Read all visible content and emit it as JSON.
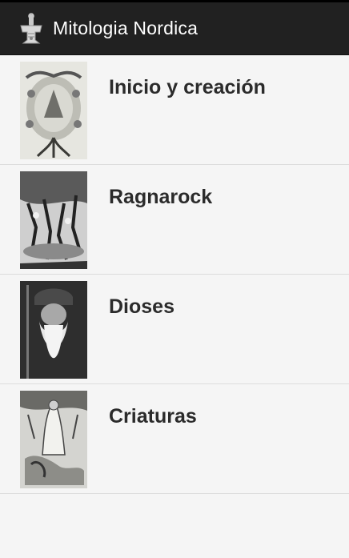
{
  "app": {
    "title": "Mitologia Nordica",
    "icon": "mjolnir-icon"
  },
  "list": {
    "items": [
      {
        "label": "Inicio y creación",
        "image": "yggdrasil-engraving"
      },
      {
        "label": "Ragnarock",
        "image": "ragnarok-battle-engraving"
      },
      {
        "label": "Dioses",
        "image": "odin-portrait"
      },
      {
        "label": "Criaturas",
        "image": "creatures-engraving"
      }
    ]
  },
  "colors": {
    "actionbar": "#212121",
    "background": "#f5f5f5",
    "divider": "#dcdcdc",
    "label": "#2b2b2b"
  }
}
